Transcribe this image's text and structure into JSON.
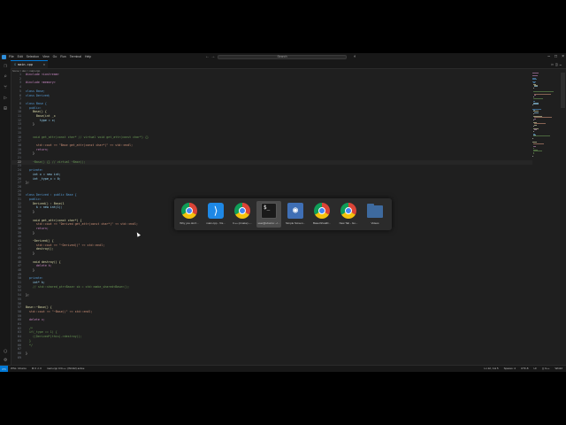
{
  "titlebar": {
    "menu": [
      "File",
      "Edit",
      "Selection",
      "View",
      "Go",
      "Run",
      "Terminal",
      "Help"
    ],
    "search_placeholder": "Search"
  },
  "tab": {
    "label": "main.cpp"
  },
  "breadcrumb": "home > dev > main.cpp",
  "code_lines": [
    {
      "n": "1",
      "t": "#include <iostream>",
      "c": "pp"
    },
    {
      "n": "2",
      "t": "",
      "c": "pl"
    },
    {
      "n": "3",
      "t": "#include <memory>",
      "c": "pp"
    },
    {
      "n": "4",
      "t": "",
      "c": "pl"
    },
    {
      "n": "5",
      "t": "class Base;",
      "c": "kw"
    },
    {
      "n": "6",
      "t": "class Derived;",
      "c": "kw"
    },
    {
      "n": "7",
      "t": "",
      "c": "pl"
    },
    {
      "n": "8",
      "t": "class Base {",
      "c": "kw"
    },
    {
      "n": "9",
      "t": "  public:",
      "c": "kw"
    },
    {
      "n": "10",
      "t": "    Base() {",
      "c": "fn"
    },
    {
      "n": "11",
      "t": "      Base(int _x",
      "c": "fn"
    },
    {
      "n": "12",
      "t": "        type = x;",
      "c": "id"
    },
    {
      "n": "13",
      "t": "    }",
      "c": "pl"
    },
    {
      "n": "14",
      "t": "",
      "c": "pl"
    },
    {
      "n": "15",
      "t": "",
      "c": "pl"
    },
    {
      "n": "16",
      "t": "    void get_attr(const char* // virtual void get_attr(const char*) {}",
      "c": "cm"
    },
    {
      "n": "17",
      "t": "",
      "c": "pl"
    },
    {
      "n": "18",
      "t": "      std::cout << \"Base get_attr(const char*)\" << std::endl;",
      "c": "st"
    },
    {
      "n": "19",
      "t": "      return;",
      "c": "pp"
    },
    {
      "n": "20",
      "t": "    }",
      "c": "pl"
    },
    {
      "n": "21",
      "t": "",
      "c": "pl"
    },
    {
      "n": "22",
      "t": "    ~Base() {} // virtual ~Base();",
      "c": "cm",
      "cur": true
    },
    {
      "n": "23",
      "t": "",
      "c": "pl"
    },
    {
      "n": "24",
      "t": "  private:",
      "c": "kw"
    },
    {
      "n": "25",
      "t": "    int x = new int;",
      "c": "id"
    },
    {
      "n": "26",
      "t": "    int _type_x = 0;",
      "c": "id"
    },
    {
      "n": "27",
      "t": "};",
      "c": "pl"
    },
    {
      "n": "28",
      "t": "",
      "c": "pl"
    },
    {
      "n": "29",
      "t": "",
      "c": "pl"
    },
    {
      "n": "30",
      "t": "class Derived : public Base {",
      "c": "kw"
    },
    {
      "n": "31",
      "t": "  public:",
      "c": "kw"
    },
    {
      "n": "32",
      "t": "    Derived() : Base(1",
      "c": "fn"
    },
    {
      "n": "33",
      "t": "      k = new int(1);",
      "c": "id"
    },
    {
      "n": "34",
      "t": "    }",
      "c": "pl"
    },
    {
      "n": "35",
      "t": "",
      "c": "pl"
    },
    {
      "n": "36",
      "t": "    void get_attr(const char*) {",
      "c": "fn"
    },
    {
      "n": "37",
      "t": "      std::cout << \"Derived get_attr(const char*)\" << std::endl;",
      "c": "st"
    },
    {
      "n": "38",
      "t": "      return;",
      "c": "pp"
    },
    {
      "n": "39",
      "t": "    }",
      "c": "pl"
    },
    {
      "n": "40",
      "t": "",
      "c": "pl"
    },
    {
      "n": "41",
      "t": "    ~Derived() {",
      "c": "fn"
    },
    {
      "n": "42",
      "t": "      std::cout << \"~Derived()\" << std::endl;",
      "c": "st"
    },
    {
      "n": "43",
      "t": "      destroy();",
      "c": "fn"
    },
    {
      "n": "44",
      "t": "    }",
      "c": "pl"
    },
    {
      "n": "45",
      "t": "",
      "c": "pl"
    },
    {
      "n": "46",
      "t": "    void destroy() {",
      "c": "fn"
    },
    {
      "n": "47",
      "t": "      delete k;",
      "c": "pp"
    },
    {
      "n": "48",
      "t": "    }",
      "c": "pl"
    },
    {
      "n": "49",
      "t": "",
      "c": "pl"
    },
    {
      "n": "50",
      "t": "  private:",
      "c": "kw"
    },
    {
      "n": "51",
      "t": "    int* k;",
      "c": "id"
    },
    {
      "n": "52",
      "t": "    // std::shared_ptr<Base> sb = std::make_shared<Base>();",
      "c": "cm"
    },
    {
      "n": "53",
      "t": "",
      "c": "pl"
    },
    {
      "n": "54",
      "t": "};",
      "c": "pl"
    },
    {
      "n": "55",
      "t": "",
      "c": "pl"
    },
    {
      "n": "56",
      "t": "",
      "c": "pl"
    },
    {
      "n": "57",
      "t": "Base::~Base() {",
      "c": "fn"
    },
    {
      "n": "58",
      "t": "  std::cout << \"~Base()\" << std::endl;",
      "c": "st"
    },
    {
      "n": "59",
      "t": "",
      "c": "pl"
    },
    {
      "n": "60",
      "t": "  delete x;",
      "c": "pp"
    },
    {
      "n": "61",
      "t": "",
      "c": "pl"
    },
    {
      "n": "62",
      "t": "  /*",
      "c": "cm"
    },
    {
      "n": "63",
      "t": "  if(_type == 1) {",
      "c": "cm"
    },
    {
      "n": "64",
      "t": "    ((Derived*)this)->destroy();",
      "c": "cm"
    },
    {
      "n": "65",
      "t": "  }",
      "c": "cm"
    },
    {
      "n": "66",
      "t": "  */",
      "c": "cm"
    },
    {
      "n": "67",
      "t": "",
      "c": "pl"
    },
    {
      "n": "68",
      "t": "}",
      "c": "pl"
    },
    {
      "n": "69",
      "t": "",
      "c": "pl"
    }
  ],
  "status": {
    "remote": "><",
    "left": [
      "WSL: Ubuntu",
      "⊗ 0 ⚠ 0",
      "main.cpp  C/C++: (Win32) active"
    ],
    "right": [
      "Ln 22, Col 5",
      "Spaces: 4",
      "UTF-8",
      "LF",
      "{} C++",
      "Win32"
    ]
  },
  "switcher": [
    {
      "label": "Why you don't...",
      "kind": "chrome"
    },
    {
      "label": "main.cpp - Vis...",
      "kind": "vscode"
    },
    {
      "label": "C++ (cmake) -...",
      "kind": "chrome"
    },
    {
      "label": "user@ubuntu: ~/...",
      "kind": "terminal",
      "selected": true
    },
    {
      "label": "Simple Screen...",
      "kind": "screenshot"
    },
    {
      "label": "BaseVirtualD...",
      "kind": "chrome"
    },
    {
      "label": "New Tab - Go...",
      "kind": "chrome"
    },
    {
      "label": "Videos",
      "kind": "folder"
    }
  ]
}
